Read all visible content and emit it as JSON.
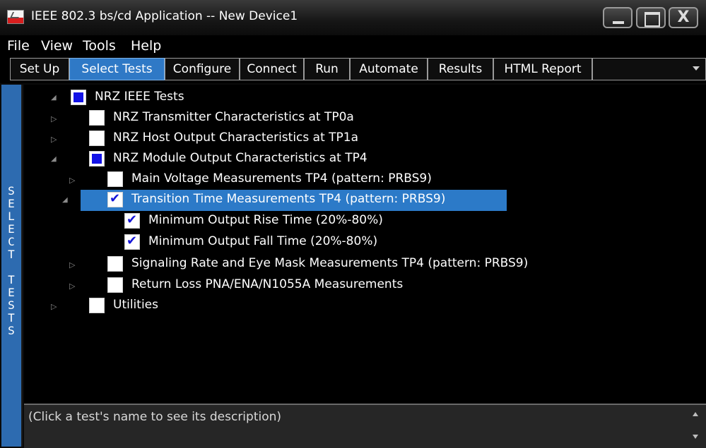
{
  "window": {
    "title": "IEEE 802.3 bs/cd Application -- New Device1",
    "close_glyph": "X"
  },
  "menu": [
    "File",
    "View",
    "Tools",
    "Help"
  ],
  "tabs": [
    {
      "label": "Set Up",
      "active": false
    },
    {
      "label": "Select Tests",
      "active": true
    },
    {
      "label": "Configure",
      "active": false
    },
    {
      "label": "Connect",
      "active": false
    },
    {
      "label": "Run",
      "active": false
    },
    {
      "label": "Automate",
      "active": false
    },
    {
      "label": "Results",
      "active": false
    },
    {
      "label": "HTML Report",
      "active": false
    }
  ],
  "side_label": "SELECT TESTS",
  "tree": [
    {
      "label": "NRZ IEEE Tests",
      "state": "partial",
      "expander": "expanded"
    },
    {
      "label": "NRZ Transmitter Characteristics at TP0a",
      "state": "unchecked",
      "expander": "collapsed"
    },
    {
      "label": "NRZ Host Output Characteristics at TP1a",
      "state": "unchecked",
      "expander": "collapsed"
    },
    {
      "label": "NRZ Module Output Characteristics at TP4",
      "state": "partial",
      "expander": "expanded"
    },
    {
      "label": "Main Voltage Measurements TP4 (pattern: PRBS9)",
      "state": "unchecked",
      "expander": "collapsed"
    },
    {
      "label": "Transition Time Measurements TP4 (pattern: PRBS9)",
      "state": "checked",
      "expander": "expanded",
      "selected": true
    },
    {
      "label": "Minimum Output Rise Time (20%-80%)",
      "state": "checked",
      "expander": "none"
    },
    {
      "label": "Minimum Output Fall Time (20%-80%)",
      "state": "checked",
      "expander": "none"
    },
    {
      "label": "Signaling Rate and Eye Mask Measurements TP4 (pattern: PRBS9)",
      "state": "unchecked",
      "expander": "collapsed"
    },
    {
      "label": "Return Loss PNA/ENA/N1055A Measurements",
      "state": "unchecked",
      "expander": "collapsed"
    },
    {
      "label": "Utilities",
      "state": "unchecked",
      "expander": "collapsed"
    }
  ],
  "description": {
    "text": "(Click a test's name to see its description)"
  },
  "colors": {
    "tab_active": "#2f79c6",
    "selection": "#2c7ac8",
    "side_strip": "#2d6bb0",
    "partial_check": "#1212e6",
    "title_icon_red": "#d81e1e"
  }
}
